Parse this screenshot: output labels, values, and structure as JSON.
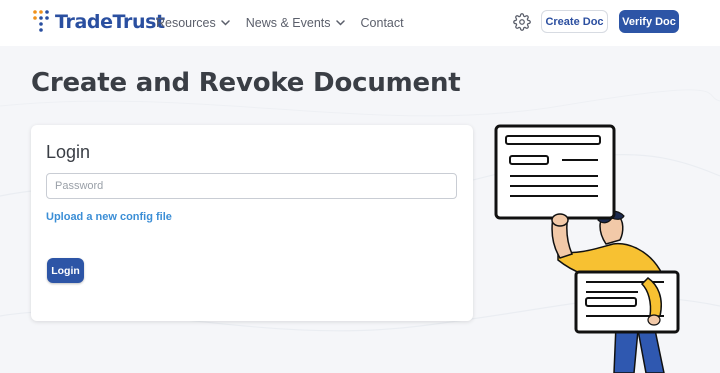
{
  "header": {
    "logo_text": "TradeTrust",
    "nav": [
      {
        "label": "Resources",
        "has_dropdown": true
      },
      {
        "label": "News & Events",
        "has_dropdown": true
      },
      {
        "label": "Contact",
        "has_dropdown": false
      }
    ],
    "settings_icon": "gear-icon",
    "create_doc_label": "Create Doc",
    "verify_doc_label": "Verify Doc"
  },
  "page_title": "Create and Revoke Document",
  "login": {
    "title": "Login",
    "password_placeholder": "Password",
    "password_value": "",
    "upload_link": "Upload a new config file",
    "login_button": "Login"
  },
  "colors": {
    "brand_blue": "#2d55a6",
    "link_blue": "#3b8ed6",
    "logo_orange": "#f0911b",
    "background": "#f5f6f9",
    "person_shirt": "#f7c132",
    "person_pants": "#2f58b0"
  }
}
